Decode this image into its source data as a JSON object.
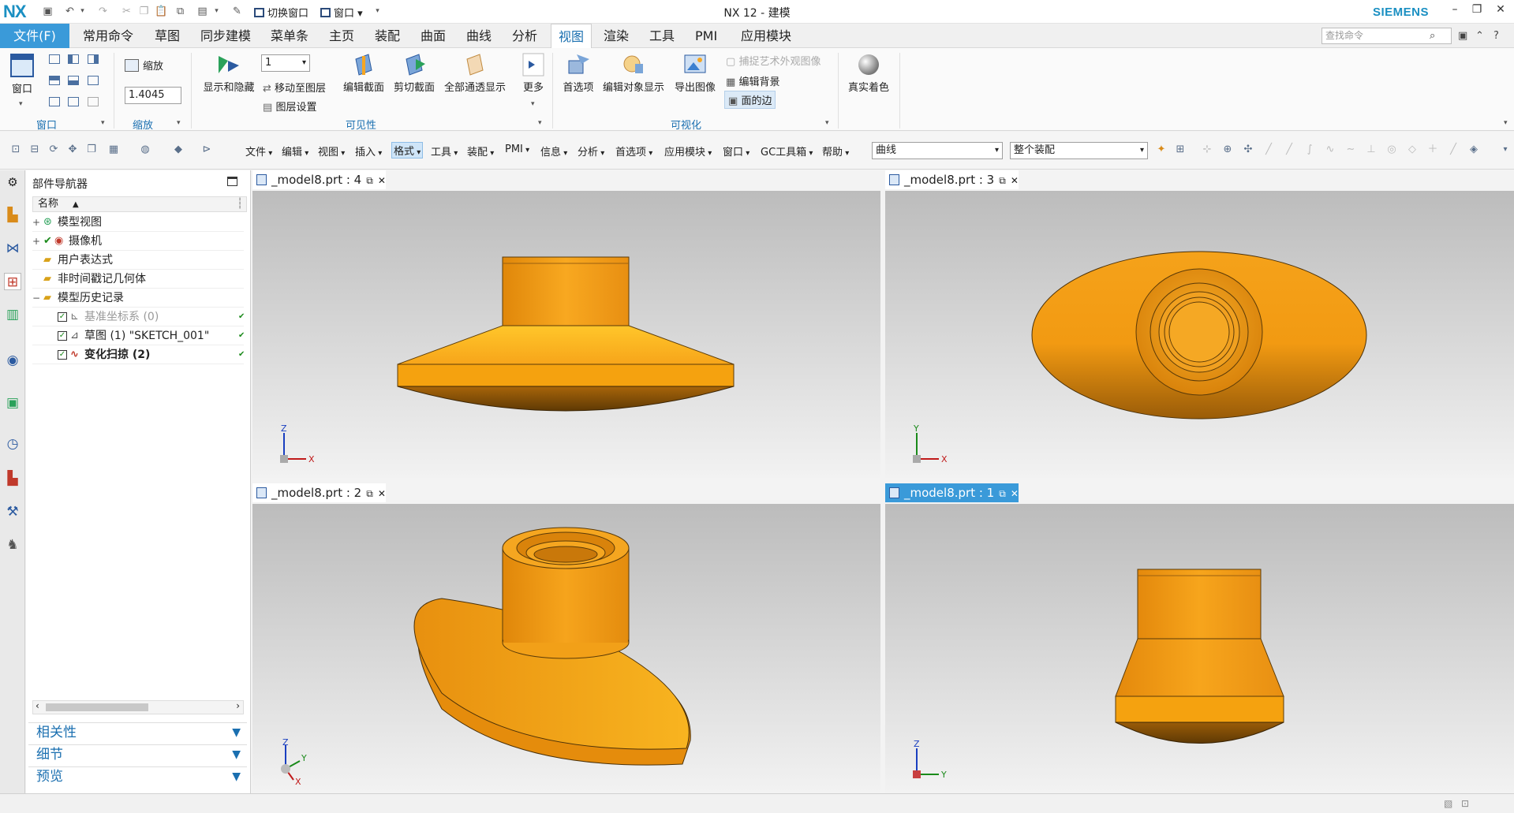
{
  "title_bar": {
    "logo": "NX",
    "switch_window": "切换窗口",
    "window_menu": "窗口",
    "app_title": "NX 12 - 建模",
    "brand": "SIEMENS"
  },
  "tabs": [
    {
      "label": "文件(F)"
    },
    {
      "label": "常用命令"
    },
    {
      "label": "草图"
    },
    {
      "label": "同步建模"
    },
    {
      "label": "菜单条"
    },
    {
      "label": "主页"
    },
    {
      "label": "装配"
    },
    {
      "label": "曲面"
    },
    {
      "label": "曲线"
    },
    {
      "label": "分析"
    },
    {
      "label": "视图"
    },
    {
      "label": "渲染"
    },
    {
      "label": "工具"
    },
    {
      "label": "PMI"
    },
    {
      "label": "应用模块"
    }
  ],
  "search": {
    "placeholder": "查找命令"
  },
  "ribbon": {
    "window_btn": "窗口",
    "group_window": "窗口",
    "zoom_label": "缩放",
    "zoom_value": "1.4045",
    "group_zoom": "缩放",
    "show_hide": "显示和隐藏",
    "layer_value": "1",
    "move_to_layer": "移动至图层",
    "layer_settings": "图层设置",
    "edit_section": "编辑截面",
    "clip_section": "剪切截面",
    "all_through": "全部通透显示",
    "more": "更多",
    "group_visibility": "可见性",
    "preferences": "首选项",
    "edit_object_display": "编辑对象显示",
    "export_image": "导出图像",
    "capture_art": "捕捉艺术外观图像",
    "edit_background": "编辑背景",
    "face_edges": "面的边",
    "group_visualization": "可视化",
    "true_shading": "真实着色"
  },
  "command_menus": [
    {
      "label": "文件"
    },
    {
      "label": "编辑"
    },
    {
      "label": "视图"
    },
    {
      "label": "插入"
    },
    {
      "label": "格式"
    },
    {
      "label": "工具"
    },
    {
      "label": "装配"
    },
    {
      "label": "PMI"
    },
    {
      "label": "信息"
    },
    {
      "label": "分析"
    },
    {
      "label": "首选项"
    },
    {
      "label": "应用模块"
    },
    {
      "label": "窗口"
    },
    {
      "label": "GC工具箱"
    },
    {
      "label": "帮助"
    }
  ],
  "filters": {
    "type": "曲线",
    "scope": "整个装配"
  },
  "navigator": {
    "title": "部件导航器",
    "column_name": "名称",
    "items": [
      {
        "label": "模型视图"
      },
      {
        "label": "摄像机"
      },
      {
        "label": "用户表达式"
      },
      {
        "label": "非时间戳记几何体"
      },
      {
        "label": "模型历史记录"
      },
      {
        "label": "基准坐标系 (0)"
      },
      {
        "label": "草图 (1) \"SKETCH_001\""
      },
      {
        "label": "变化扫掠 (2)"
      }
    ],
    "panels": [
      {
        "label": "相关性"
      },
      {
        "label": "细节"
      },
      {
        "label": "预览"
      }
    ]
  },
  "viewports": [
    {
      "title": "_model8.prt : 4",
      "axis_v": "Z",
      "axis_h": "X"
    },
    {
      "title": "_model8.prt : 3",
      "axis_v": "Y",
      "axis_h": "X"
    },
    {
      "title": "_model8.prt : 2",
      "axis_v": "Z",
      "axis_h": "Y",
      "axis_o": "X"
    },
    {
      "title": "_model8.prt : 1",
      "axis_v": "Z",
      "axis_h": "Y"
    }
  ],
  "colors": {
    "accent": "#3a9ad9",
    "model": "#f5a623",
    "model_dark": "#7a4a05"
  }
}
